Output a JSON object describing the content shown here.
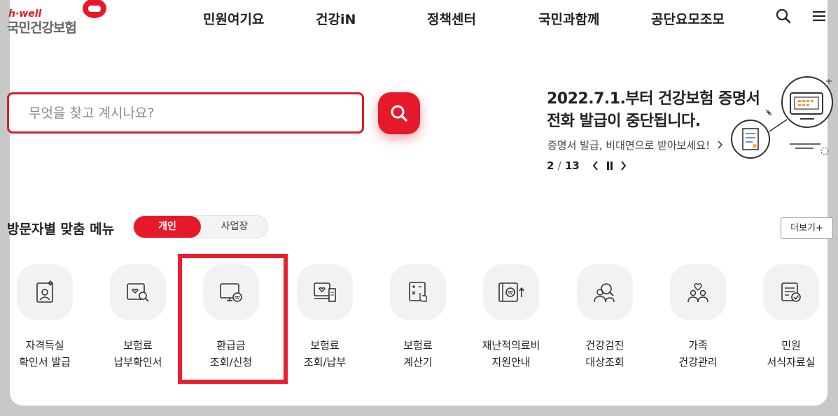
{
  "header": {
    "logo_sub": "h·well",
    "logo_main": "국민건강보험",
    "nav": [
      "민원여기요",
      "건강iN",
      "정책센터",
      "국민과함께",
      "공단요모조모"
    ],
    "icons": [
      "search-icon",
      "hamburger-menu-icon"
    ]
  },
  "search": {
    "placeholder": "무엇을 찾고 계시나요?"
  },
  "notice": {
    "title_line1": "2022.7.1.부터 건강보험 증명서",
    "title_line2": "전화 발급이 중단됩니다.",
    "subtitle": "증명서 발급, 비대면으로 받아보세요!",
    "current": "2",
    "separator": "/",
    "total": "13"
  },
  "visitor_menu": {
    "title": "방문자별 맞춤 메뉴",
    "tabs": [
      "개인",
      "사업장"
    ],
    "active_tab": "개인",
    "more_label": "더보기+",
    "items": [
      {
        "line1": "자격득실",
        "line2": "확인서 발급",
        "icon": "qualification-certificate-icon"
      },
      {
        "line1": "보험료",
        "line2": "납부확인서",
        "icon": "payment-confirmation-icon"
      },
      {
        "line1": "환급금",
        "line2": "조회/신청",
        "icon": "refund-monitor-icon"
      },
      {
        "line1": "보험료",
        "line2": "조회/납부",
        "icon": "premium-inquiry-icon"
      },
      {
        "line1": "보험료",
        "line2": "계산기",
        "icon": "calculator-icon"
      },
      {
        "line1": "재난적의료비",
        "line2": "지원안내",
        "icon": "medical-cost-support-icon"
      },
      {
        "line1": "건강검진",
        "line2": "대상조회",
        "icon": "health-checkup-icon"
      },
      {
        "line1": "가족",
        "line2": "건강관리",
        "icon": "family-health-icon"
      },
      {
        "line1": "민원",
        "line2": "서식자료실",
        "icon": "civil-forms-icon"
      }
    ]
  },
  "colors": {
    "accent": "#e6192b",
    "highlight_border": "#e8202e",
    "background": "#c8c8c8"
  }
}
